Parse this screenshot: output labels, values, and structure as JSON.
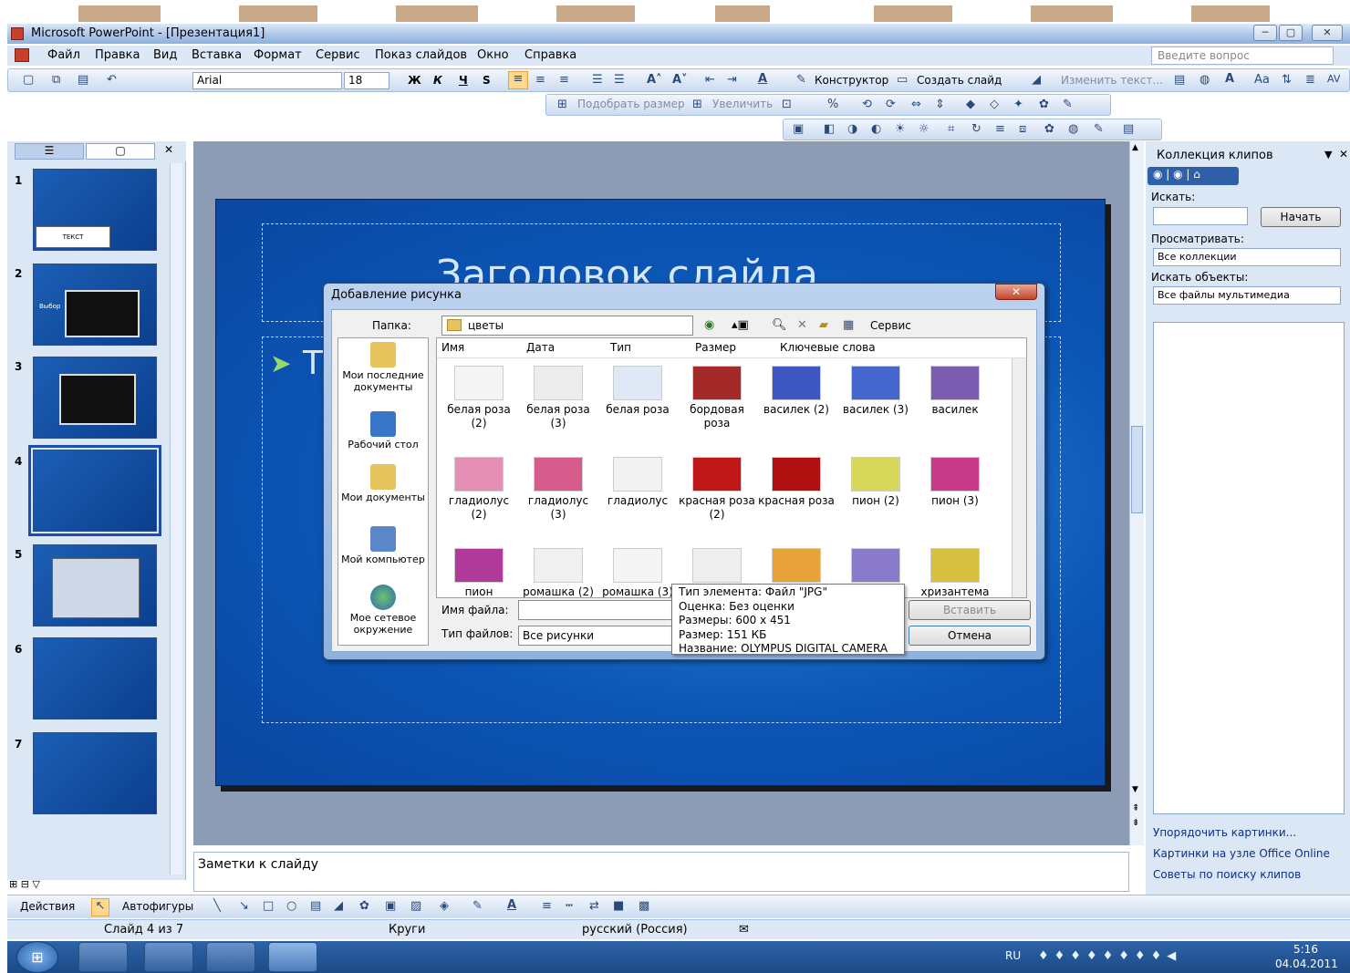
{
  "window": {
    "title": "Microsoft PowerPoint - [Презентация1]"
  },
  "menu": {
    "items": [
      "Файл",
      "Правка",
      "Вид",
      "Вставка",
      "Формат",
      "Сервис",
      "Показ слайдов",
      "Окно",
      "Справка"
    ],
    "ask_placeholder": "Введите вопрос"
  },
  "toolbar": {
    "font": "Arial",
    "size": "18",
    "bold": "Ж",
    "italic": "К",
    "underline": "Ч",
    "shadow": "S",
    "designer": "Конструктор",
    "new_slide": "Создать слайд",
    "change_text": "Изменить текст...",
    "fit_size": "Подобрать размер",
    "enlarge": "Увеличить"
  },
  "slides": {
    "numbers": [
      "1",
      "2",
      "3",
      "4",
      "5",
      "6",
      "7"
    ],
    "selected": "4",
    "thumb1_caption": "ТЕКСТ",
    "thumb2_caption": "Выбор"
  },
  "slide": {
    "title": "Заголовок слайда",
    "body_bullet": "Т"
  },
  "notes": {
    "placeholder": "Заметки к слайду"
  },
  "dialog": {
    "title": "Добавление рисунка",
    "folder_label": "Папка:",
    "folder_value": "цветы",
    "service": "Сервис",
    "places": [
      "Мои последние документы",
      "Рабочий стол",
      "Мои документы",
      "Мой компьютер",
      "Мое сетевое окружение"
    ],
    "columns": [
      "Имя",
      "Дата",
      "Тип",
      "Размер",
      "Ключевые слова"
    ],
    "files": [
      "белая роза (2)",
      "белая роза (3)",
      "белая роза",
      "бордовая роза",
      "василек (2)",
      "василек (3)",
      "василек",
      "гладиолус (2)",
      "гладиолус (3)",
      "гладиолус",
      "красная роза (2)",
      "красная роза",
      "пион (2)",
      "пион (3)",
      "пион",
      "ромашка (2)",
      "ромашка (3)",
      "",
      "",
      "",
      "хризантема"
    ],
    "filename_label": "Имя файла:",
    "filetype_label": "Тип файлов:",
    "filetype_value": "Все рисунки",
    "insert_btn": "Вставить",
    "cancel_btn": "Отмена"
  },
  "tooltip": {
    "lines": [
      "Тип элемента: Файл \"JPG\"",
      "Оценка: Без оценки",
      "Размеры: 600 x 451",
      "Размер: 151 КБ",
      "Название: OLYMPUS DIGITAL CAMERA"
    ]
  },
  "taskpane": {
    "title": "Коллекция клипов",
    "search_label": "Искать:",
    "go_btn": "Начать",
    "browse_label": "Просматривать:",
    "browse_value": "Все коллекции",
    "objects_label": "Искать объекты:",
    "objects_value": "Все файлы мультимедиа",
    "links": [
      "Упорядочить картинки...",
      "Картинки на узле Office Online",
      "Советы по поиску клипов"
    ]
  },
  "drawing": {
    "actions": "Действия",
    "autoshapes": "Автофигуры"
  },
  "status": {
    "slide": "Слайд 4 из 7",
    "design": "Круги",
    "lang": "русский (Россия)"
  },
  "tray": {
    "lang": "RU",
    "time": "5:16",
    "date": "04.04.2011"
  }
}
